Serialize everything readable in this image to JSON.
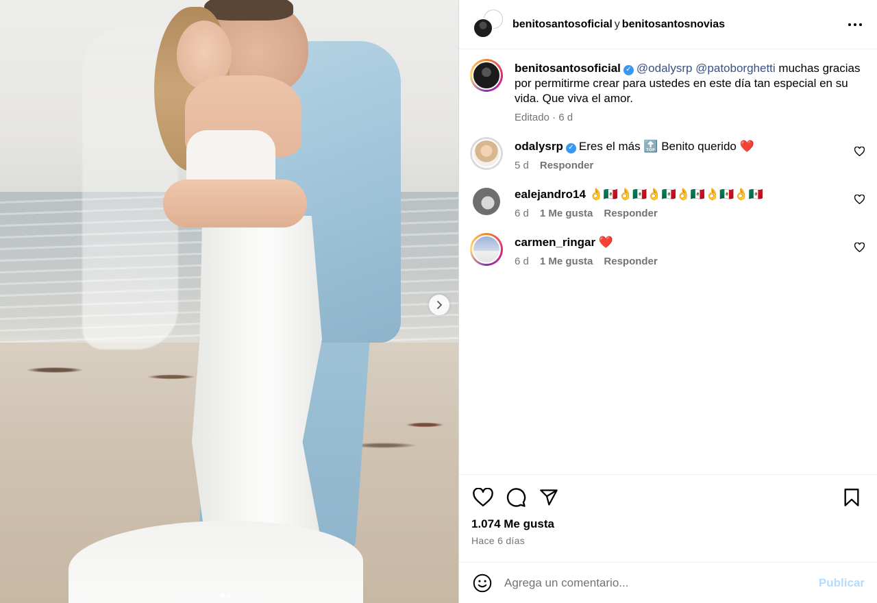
{
  "post": {
    "media": {
      "image_description_alt": "",
      "carousel_count": 2,
      "carousel_active": 0
    },
    "header": {
      "user1": "benitosantosoficial",
      "joiner": "y",
      "user2": "benitosantosnovias"
    },
    "caption": {
      "username": "benitosantosoficial",
      "mention1": "@odalysrp",
      "mention2": "@patoborghetti",
      "text": " muchas gracias por permitirme crear para ustedes en este día tan especial en su vida. Que viva el amor.",
      "meta": "Editado · 6 d"
    },
    "comments": [
      {
        "username": "odalysrp",
        "verified": true,
        "text": "Eres el más 🔝 Benito querido ❤️",
        "time": "5 d",
        "likes": "",
        "reply": "Responder"
      },
      {
        "username": "ealejandro14",
        "verified": false,
        "text": "👌🇲🇽👌🇲🇽👌🇲🇽👌🇲🇽👌🇲🇽👌🇲🇽",
        "time": "6 d",
        "likes": "1 Me gusta",
        "reply": "Responder"
      },
      {
        "username": "carmen_ringar",
        "verified": false,
        "text": "❤️",
        "time": "6 d",
        "likes": "1 Me gusta",
        "reply": "Responder"
      }
    ],
    "likes_count": "1.074 Me gusta",
    "posted_ago": "Hace 6 días",
    "comment_input": {
      "placeholder": "Agrega un comentario...",
      "value": ""
    },
    "publish_label": "Publicar"
  },
  "colors": {
    "link": "#385185",
    "verified": "#3897f0",
    "muted": "#737373",
    "publish_disabled": "#b3dbff"
  }
}
